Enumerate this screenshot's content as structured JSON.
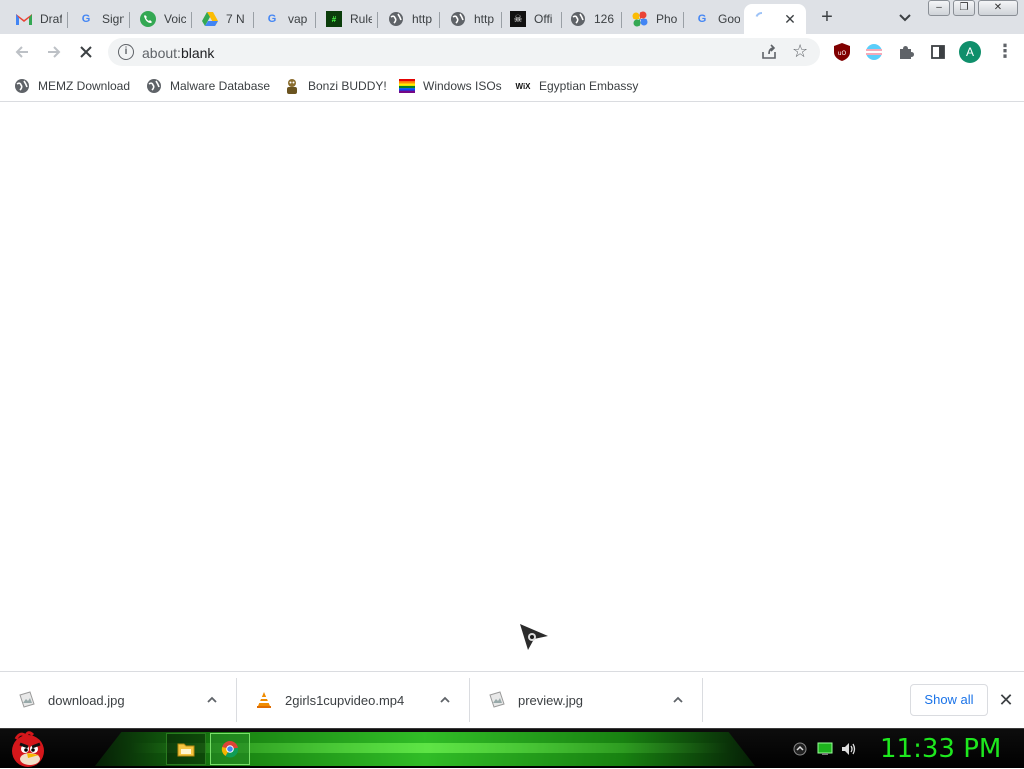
{
  "browser": {
    "tabs": [
      {
        "title": "Draf",
        "icon": "gmail-icon"
      },
      {
        "title": "Sign",
        "icon": "google-icon"
      },
      {
        "title": "Voic",
        "icon": "phone-icon"
      },
      {
        "title": "7 N",
        "icon": "drive-icon"
      },
      {
        "title": "vap",
        "icon": "google-icon"
      },
      {
        "title": "Rule",
        "icon": "matrix-icon"
      },
      {
        "title": "http",
        "icon": "globe-icon"
      },
      {
        "title": "http",
        "icon": "globe-icon"
      },
      {
        "title": "Offi",
        "icon": "pirate-icon"
      },
      {
        "title": "126",
        "icon": "globe-icon"
      },
      {
        "title": "Pho",
        "icon": "photos-icon"
      },
      {
        "title": "Goo",
        "icon": "google-icon"
      },
      {
        "title": "",
        "icon": "loading-icon",
        "active": true
      }
    ],
    "new_tab_label": "+",
    "address": {
      "scheme": "about:",
      "host": "blank"
    },
    "profile_initial": "A",
    "bookmarks": [
      {
        "label": "MEMZ Download",
        "icon": "globe-icon"
      },
      {
        "label": "Malware Database",
        "icon": "globe-icon"
      },
      {
        "label": "Bonzi BUDDY!",
        "icon": "bonzi-icon"
      },
      {
        "label": "Windows ISOs",
        "icon": "rainbow-flag-icon"
      },
      {
        "label": "Egyptian Embassy",
        "icon": "wix-icon",
        "icon_text": "WiX"
      }
    ]
  },
  "downloads": {
    "items": [
      {
        "name": "download.jpg",
        "icon": "image-file-icon"
      },
      {
        "name": "2girls1cupvideo.mp4",
        "icon": "vlc-icon"
      },
      {
        "name": "preview.jpg",
        "icon": "image-file-icon"
      }
    ],
    "show_all_label": "Show all"
  },
  "taskbar": {
    "clock": "11:33 PM",
    "pinned": [
      {
        "name": "file-explorer",
        "icon": "folder-icon"
      },
      {
        "name": "chrome",
        "icon": "chrome-icon",
        "active": true
      }
    ]
  },
  "colors": {
    "accent": "#1a73e8",
    "tab_strip": "#dee1e6",
    "clock": "#1ee81e",
    "taskbar_glow": "#35d12a"
  }
}
